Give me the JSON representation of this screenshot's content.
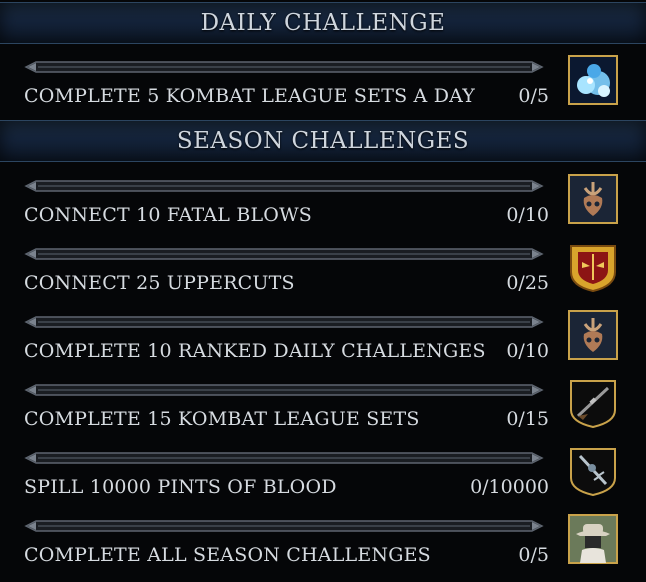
{
  "daily": {
    "heading": "DAILY CHALLENGE",
    "challenges": [
      {
        "label": "COMPLETE 5 KOMBAT LEAGUE SETS A DAY",
        "count": "0/5",
        "progress": 0,
        "icon": "soul-orbs-icon"
      }
    ]
  },
  "season": {
    "heading": "SEASON CHALLENGES",
    "challenges": [
      {
        "label": "CONNECT 10 FATAL BLOWS",
        "count": "0/10",
        "progress": 0,
        "icon": "kombat-emblem-icon"
      },
      {
        "label": "CONNECT 25 UPPERCUTS",
        "count": "0/25",
        "progress": 0,
        "icon": "gold-mask-icon"
      },
      {
        "label": "COMPLETE 10 RANKED DAILY CHALLENGES",
        "count": "0/10",
        "progress": 0,
        "icon": "kombat-emblem-icon"
      },
      {
        "label": "COMPLETE 15 KOMBAT LEAGUE SETS",
        "count": "0/15",
        "progress": 0,
        "icon": "rifle-weapon-icon"
      },
      {
        "label": "SPILL 10000 PINTS OF BLOOD",
        "count": "0/10000",
        "progress": 0,
        "icon": "blade-weapon-icon"
      },
      {
        "label": "COMPLETE ALL SEASON CHALLENGES",
        "count": "0/5",
        "progress": 0,
        "icon": "cowboy-character-icon"
      }
    ]
  },
  "colors": {
    "header_bg": "#14233a",
    "text": "#d6dbe0",
    "track": "#5e6570",
    "frame_gold": "#c9a24a"
  }
}
